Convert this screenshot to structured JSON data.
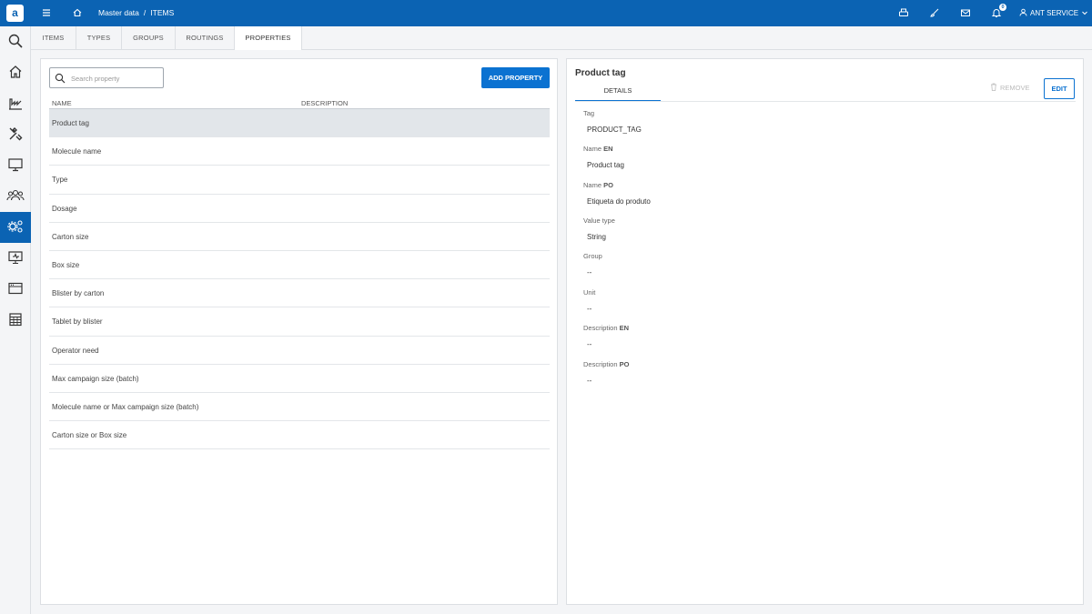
{
  "header": {
    "logo_letter": "a",
    "breadcrumb": [
      "Master data",
      "ITEMS"
    ],
    "breadcrumb_sep": "/",
    "notifications_count": "0",
    "user_name": "ANT SERVICE"
  },
  "tabs": [
    {
      "label": "ITEMS",
      "active": false
    },
    {
      "label": "TYPES",
      "active": false
    },
    {
      "label": "GROUPS",
      "active": false
    },
    {
      "label": "ROUTINGS",
      "active": false
    },
    {
      "label": "PROPERTIES",
      "active": true
    }
  ],
  "properties_list": {
    "search_placeholder": "Search property",
    "add_button": "ADD PROPERTY",
    "columns": [
      "NAME",
      "DESCRIPTION"
    ],
    "rows": [
      {
        "name": "Product tag",
        "selected": true
      },
      {
        "name": "Molecule name",
        "selected": false
      },
      {
        "name": "Type",
        "selected": false
      },
      {
        "name": "Dosage",
        "selected": false
      },
      {
        "name": "Carton size",
        "selected": false
      },
      {
        "name": "Box size",
        "selected": false
      },
      {
        "name": "Blister by carton",
        "selected": false
      },
      {
        "name": "Tablet by blister",
        "selected": false
      },
      {
        "name": "Operator need",
        "selected": false
      },
      {
        "name": "Max campaign size (batch)",
        "selected": false
      },
      {
        "name": "Molecule name or Max campaign size (batch)",
        "selected": false
      },
      {
        "name": "Carton size or Box size",
        "selected": false
      }
    ]
  },
  "detail": {
    "title": "Product tag",
    "tab": "DETAILS",
    "remove_button": "REMOVE",
    "edit_button": "EDIT",
    "fields": [
      {
        "label": "Tag",
        "suffix": "",
        "value": "PRODUCT_TAG"
      },
      {
        "label": "Name",
        "suffix": "EN",
        "value": "Product tag"
      },
      {
        "label": "Name",
        "suffix": "PO",
        "value": "Etiqueta do produto"
      },
      {
        "label": "Value type",
        "suffix": "",
        "value": "String"
      },
      {
        "label": "Group",
        "suffix": "",
        "value": "--"
      },
      {
        "label": "Unit",
        "suffix": "",
        "value": "--"
      },
      {
        "label": "Description",
        "suffix": "EN",
        "value": "--"
      },
      {
        "label": "Description",
        "suffix": "PO",
        "value": "--"
      }
    ]
  },
  "sidebar": {
    "items": [
      {
        "icon": "search-icon",
        "active": false
      },
      {
        "icon": "home-icon",
        "active": false
      },
      {
        "icon": "production-chart-icon",
        "active": false
      },
      {
        "icon": "tools-icon",
        "active": false
      },
      {
        "icon": "monitor-icon",
        "active": false
      },
      {
        "icon": "users-icon",
        "active": false
      },
      {
        "icon": "master-data-gears-icon",
        "active": true
      },
      {
        "icon": "monitor-add-icon",
        "active": false
      },
      {
        "icon": "window-icon",
        "active": false
      },
      {
        "icon": "calendar-icon",
        "active": false
      }
    ]
  },
  "colors": {
    "brand": "#0b63b3",
    "primary_button": "#0b72d1",
    "selected_row": "#e2e6ea"
  }
}
